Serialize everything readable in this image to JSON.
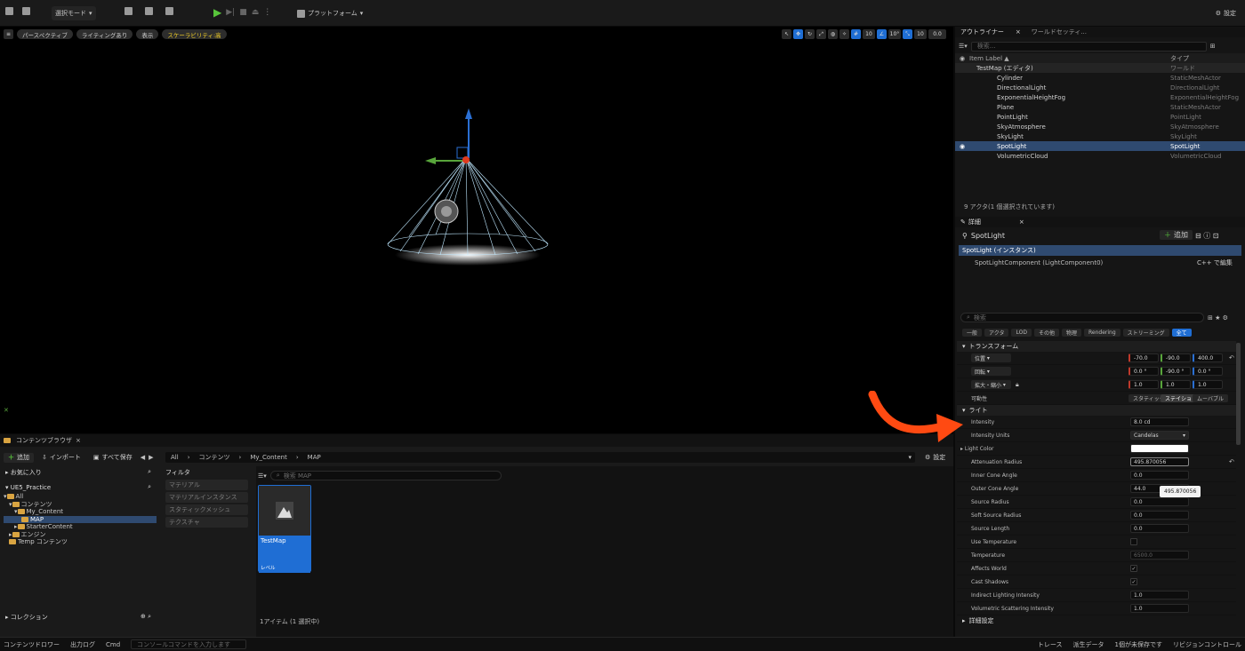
{
  "toolbar": {
    "mode": "選択モード",
    "platform": "プラットフォーム",
    "settings": "設定"
  },
  "viewport": {
    "perspective": "パースペクティブ",
    "lighting": "ライティングあり",
    "show": "表示",
    "scalability": "スケーラビリティ:高",
    "grid_snap": "10",
    "rot_snap": "10°",
    "scale_snap": "10",
    "cam_speed": "0.0"
  },
  "content_browser": {
    "tab": "コンテンツブラウザ",
    "add": "追加",
    "import": "インポート",
    "save_all": "すべて保存",
    "breadcrumbs": [
      "All",
      "コンテンツ",
      "My_Content",
      "MAP"
    ],
    "settings": "設定",
    "favorites": "お気に入り",
    "project": "UE5_Practice",
    "tree": [
      "All",
      "コンテンツ",
      "My_Content",
      "MAP",
      "StarterContent",
      "エンジン",
      "Temp コンテンツ"
    ],
    "collections": "コレクション",
    "filter_title": "フィルタ",
    "filters": [
      "マテリアル",
      "マテリアルインスタンス",
      "スタティックメッシュ",
      "テクスチャ"
    ],
    "search_placeholder": "検索 MAP",
    "asset_name": "TestMap",
    "asset_type": "レベル",
    "item_count": "1アイテム (1 選択中)"
  },
  "status": {
    "drawer": "コンテンツドロワー",
    "output": "出力ログ",
    "cmd": "Cmd",
    "console_placeholder": "コンソールコマンドを入力します",
    "trace": "トレース",
    "derived": "派生データ",
    "unsaved": "1個が未保存です",
    "source": "リビジョンコントロール"
  },
  "outliner": {
    "tab": "アウトライナー",
    "tab2": "ワールドセッティ...",
    "search": "検索...",
    "col_label": "Item Label ▲",
    "col_type": "タイプ",
    "rows": [
      {
        "label": "TestMap (エディタ)",
        "type": "ワールド"
      },
      {
        "label": "Cylinder",
        "type": "StaticMeshActor"
      },
      {
        "label": "DirectionalLight",
        "type": "DirectionalLight"
      },
      {
        "label": "ExponentialHeightFog",
        "type": "ExponentialHeightFog"
      },
      {
        "label": "Plane",
        "type": "StaticMeshActor"
      },
      {
        "label": "PointLight",
        "type": "PointLight"
      },
      {
        "label": "SkyAtmosphere",
        "type": "SkyAtmosphere"
      },
      {
        "label": "SkyLight",
        "type": "SkyLight"
      },
      {
        "label": "SpotLight",
        "type": "SpotLight"
      },
      {
        "label": "VolumetricCloud",
        "type": "VolumetricCloud"
      }
    ],
    "count": "9 アクタ(1 個選択されています)"
  },
  "details": {
    "tab": "詳細",
    "actor": "SpotLight",
    "add": "追加",
    "instance": "SpotLight (インスタンス)",
    "component": "SpotLightComponent (LightComponent0)",
    "edit": "C++ で編集",
    "search": "検索",
    "categories": [
      "一般",
      "アクタ",
      "LOD",
      "その他",
      "物理",
      "Rendering",
      "ストリーミング",
      "全て"
    ],
    "transform": "トランスフォーム",
    "location": "位置",
    "rotation": "回転",
    "scale": "拡大・縮小",
    "loc": [
      "-70.0",
      "-90.0",
      "400.0"
    ],
    "rot": [
      "0.0 °",
      "-90.0 °",
      "0.0 °"
    ],
    "scl": [
      "1.0",
      "1.0",
      "1.0"
    ],
    "mobility": "可動性",
    "mob_opts": [
      "スタティック",
      "ステイショ",
      "ムーバブル"
    ],
    "light": "ライト",
    "props": [
      {
        "label": "Intensity",
        "value": "8.0 cd"
      },
      {
        "label": "Intensity Units",
        "value": "Candelas"
      },
      {
        "label": "Light Color",
        "value": ""
      },
      {
        "label": "Attenuation Radius",
        "value": "495.870056"
      },
      {
        "label": "Inner Cone Angle",
        "value": "0.0"
      },
      {
        "label": "Outer Cone Angle",
        "value": "44.0"
      },
      {
        "label": "Source Radius",
        "value": "0.0"
      },
      {
        "label": "Soft Source Radius",
        "value": "0.0"
      },
      {
        "label": "Source Length",
        "value": "0.0"
      },
      {
        "label": "Use Temperature",
        "value": ""
      },
      {
        "label": "Temperature",
        "value": "6500.0"
      },
      {
        "label": "Affects World",
        "value": "✓"
      },
      {
        "label": "Cast Shadows",
        "value": "✓"
      },
      {
        "label": "Indirect Lighting Intensity",
        "value": "1.0"
      },
      {
        "label": "Volumetric Scattering Intensity",
        "value": "1.0"
      }
    ],
    "tooltip": "495.870056",
    "advanced": "詳細設定"
  }
}
